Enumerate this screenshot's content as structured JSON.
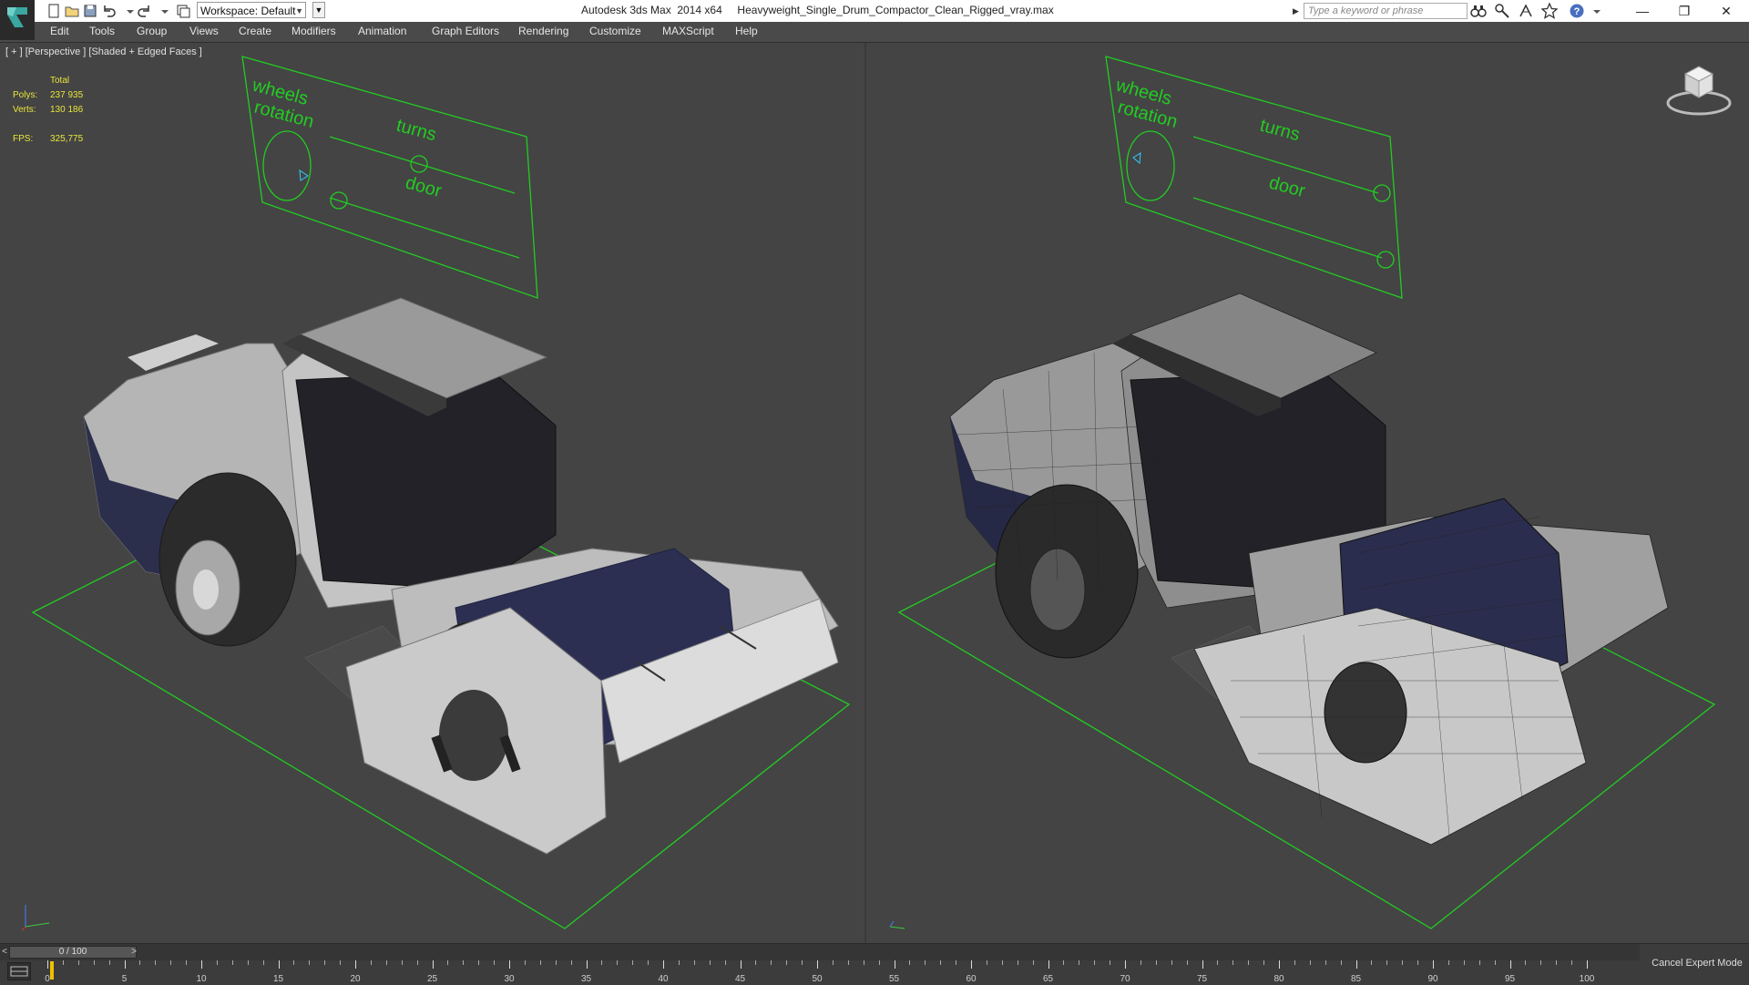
{
  "titlebar": {
    "workspace_label": "Workspace: Default",
    "title": "Autodesk 3ds Max  2014 x64     Heavyweight_Single_Drum_Compactor_Clean_Rigged_vray.max",
    "search_placeholder": "Type a keyword or phrase",
    "minimize": "—",
    "restore": "❐",
    "close": "✕"
  },
  "menu": {
    "items": [
      "Edit",
      "Tools",
      "Group",
      "Views",
      "Create",
      "Modifiers",
      "Animation",
      "Graph Editors",
      "Rendering",
      "Customize",
      "MAXScript",
      "Help"
    ]
  },
  "viewport_left": {
    "label": "[ + ] [Perspective ] [Shaded + Edged Faces ]",
    "stats": {
      "total_label": "Total",
      "polys_label": "Polys:",
      "polys_value": "237 935",
      "verts_label": "Verts:",
      "verts_value": "130 186",
      "fps_label": "FPS:",
      "fps_value": "325,775"
    },
    "control_panel": {
      "wheels_label": "wheels",
      "rotation_label": "rotation",
      "turns_label": "turns",
      "door_label": "door"
    }
  },
  "viewport_right": {
    "control_panel": {
      "wheels_label": "wheels",
      "rotation_label": "rotation",
      "turns_label": "turns",
      "door_label": "door"
    }
  },
  "timeline": {
    "slider_value": "0 / 100",
    "slider_left": "<",
    "slider_right": ">",
    "ticks": [
      0,
      5,
      10,
      15,
      20,
      25,
      30,
      35,
      40,
      45,
      50,
      55,
      60,
      65,
      70,
      75,
      80,
      85,
      90,
      95,
      100
    ],
    "current_frame": 0
  },
  "status": {
    "expert_mode_button": "Cancel Expert Mode"
  },
  "colors": {
    "viewport_bg": "#444444",
    "helper_green": "#22cc22",
    "stats_yellow": "#e8e53a",
    "drum_blue": "#2b2f52",
    "body_grey": "#b9b9b9"
  }
}
